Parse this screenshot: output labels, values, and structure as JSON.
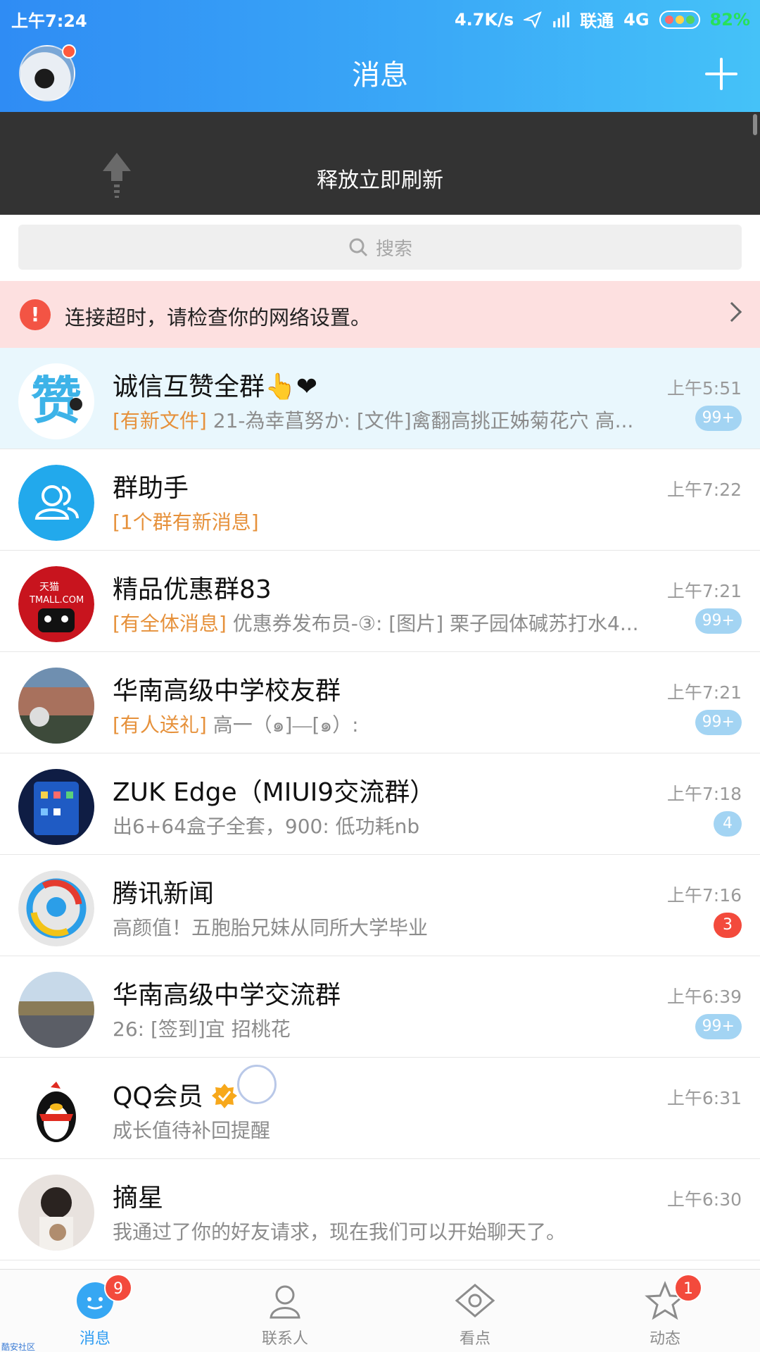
{
  "status_bar": {
    "time": "上午7:24",
    "speed": "4.7K/s",
    "carrier": "联通",
    "network": "4G",
    "battery": "82%"
  },
  "header": {
    "title": "消息"
  },
  "refresh": {
    "text": "释放立即刷新"
  },
  "search": {
    "placeholder": "搜索"
  },
  "warning": {
    "text": "连接超时，请检查你的网络设置。"
  },
  "conversations": [
    {
      "name": "诚信互赞全群👆❤",
      "tag": "[有新文件]",
      "message": " 21-為幸菖努か: [文件]禽翻高挑正姊菊花穴 高...",
      "time": "上午5:51",
      "badge": "99+"
    },
    {
      "name": "群助手",
      "tag": "[1个群有新消息]",
      "message": "",
      "time": "上午7:22",
      "badge": ""
    },
    {
      "name": "精品优惠群83",
      "tag": "[有全体消息]",
      "message": " 优惠券发布员-③: [图片] 栗子园体碱苏打水4...",
      "time": "上午7:21",
      "badge": "99+"
    },
    {
      "name": "华南高级中学校友群",
      "tag": "[有人送礼]",
      "message": " 高一（๑]⎯⎯[๑）:",
      "time": "上午7:21",
      "badge": "99+"
    },
    {
      "name": "ZUK Edge（MIUI9交流群）",
      "tag": "",
      "message": "出6+64盒子全套，900: 低功耗nb",
      "time": "上午7:18",
      "badge": "4"
    },
    {
      "name": "腾讯新闻",
      "tag": "",
      "message": "高颜值！五胞胎兄妹从同所大学毕业",
      "time": "上午7:16",
      "badge": "3"
    },
    {
      "name": "华南高级中学交流群",
      "tag": "",
      "message": "26: [签到]宜 招桃花",
      "time": "上午6:39",
      "badge": "99+"
    },
    {
      "name": "QQ会员",
      "tag": "",
      "message": "成长值待补回提醒",
      "time": "上午6:31",
      "badge": ""
    },
    {
      "name": "摘星",
      "tag": "",
      "message": "我通过了你的好友请求，现在我们可以开始聊天了。",
      "time": "上午6:30",
      "badge": ""
    }
  ],
  "tabs": [
    {
      "label": "消息",
      "badge": "9",
      "icon": "chat-icon"
    },
    {
      "label": "联系人",
      "badge": "",
      "icon": "contacts-icon"
    },
    {
      "label": "看点",
      "badge": "",
      "icon": "eye-icon"
    },
    {
      "label": "动态",
      "badge": "1",
      "icon": "star-icon"
    }
  ],
  "watermark": "酷安社区",
  "colors": {
    "accent": "#2e9cf2",
    "badge_red": "#f34a3c",
    "badge_blue": "#a3d4f3",
    "tag_orange": "#e6913b"
  }
}
